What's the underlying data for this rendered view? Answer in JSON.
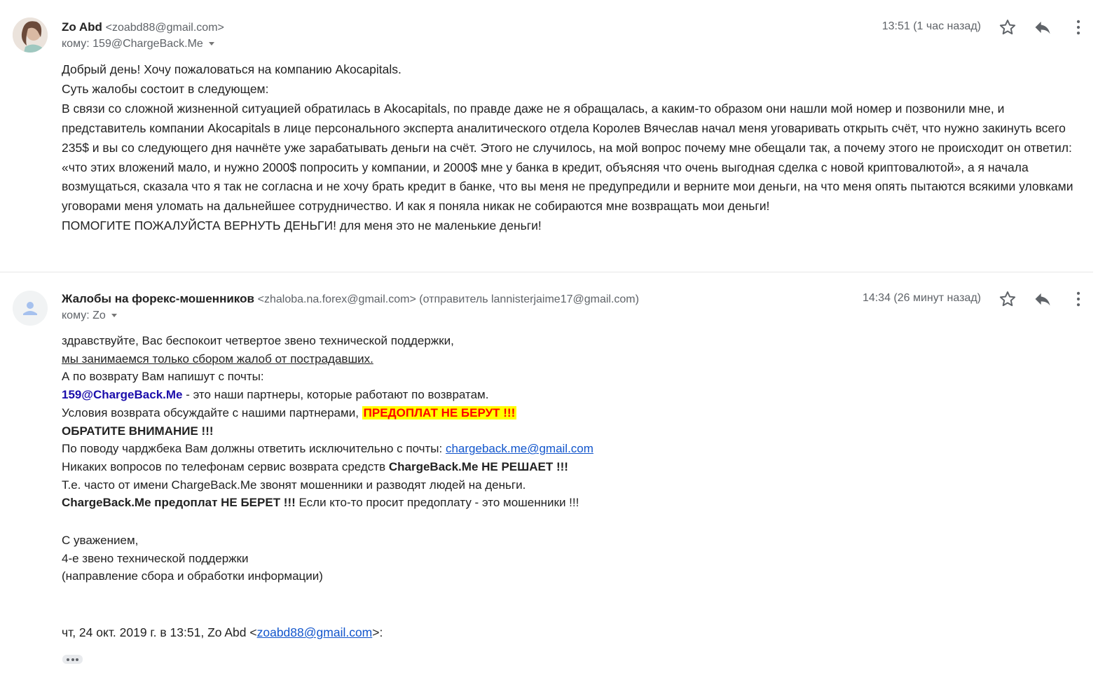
{
  "messages": [
    {
      "sender_name": "Zo Abd",
      "sender_email": "<zoabd88@gmail.com>",
      "to": "кому: 159@ChargeBack.Me",
      "time": "13:51 (1 час назад)",
      "body": [
        "Добрый день! Хочу пожаловаться на компанию Akocapitals.",
        "Суть жалобы состоит в следующем:",
        "В связи со сложной жизненной ситуацией обратилась в Akocapitals, по правде даже не я обращалась, а каким-то образом они нашли мой номер и позвонили мне, и представитель компании Akocapitals в лице персонального эксперта аналитического отдела Королев Вячеслав начал меня уговаривать открыть счёт, что нужно закинуть всего 235$ и вы со следующего дня начнёте уже зарабатывать деньги на счёт. Этого не случилось, на мой вопрос почему мне обещали так, а почему этого не происходит он ответил: «что этих вложений мало, и нужно 2000$ попросить у компании, и 2000$ мне у банка в кредит, объясняя что очень выгодная сделка с новой криптовалютой», а я начала возмущаться, сказала что я так не согласна и не хочу брать кредит в банке, что вы меня не предупредили и верните мои деньги, на что меня опять пытаются всякими уловками уговорами меня уломать на дальнейшее сотрудничество. И как я поняла никак не собираются мне возвращать мои деньги!",
        "ПОМОГИТЕ ПОЖАЛУЙСТА ВЕРНУТЬ ДЕНЬГИ! для меня это не маленькие деньги!"
      ]
    },
    {
      "sender_name": "Жалобы на форекс-мошенников",
      "sender_email": "<zhaloba.na.forex@gmail.com> (отправитель lannisterjaime17@gmail.com)",
      "to": "кому: Zo",
      "time": "14:34 (26 минут назад)",
      "body": {
        "l1": "здравствуйте, Вас беспокоит четвертое звено технической поддержки,",
        "l2": "мы занимаемся только сбором жалоб от пострадавших.",
        "l3": "А по возврату Вам напишут с почты:",
        "l4_email": "159@ChargeBack.Me",
        "l4_text": " - это наши партнеры, которые работают по возвратам.",
        "l5_text": "Условия возврата обсуждайте с нашими партнерами, ",
        "l5_warn": "ПРЕДОПЛАТ НЕ БЕРУТ !!!",
        "l6": "ОБРАТИТЕ ВНИМАНИЕ !!!",
        "l7_text": "По поводу чарджбека Вам должны ответить исключительно с почты: ",
        "l7_link": "chargeback.me@gmail.com",
        "l8_text": "Никаких вопросов по телефонам сервис возврата средств ",
        "l8_bold": "ChargeBack.Me НЕ РЕШАЕТ !!!",
        "l9": "Т.е. часто от имени ChargeBack.Me звонят мошенники и разводят людей на деньги.",
        "l10_bold": "ChargeBack.Me предоплат НЕ БЕРЕТ !!!",
        "l10_text": " Если кто-то просит предоплату - это мошенники !!!",
        "sig1": "С уважением,",
        "sig2": "4-е звено технической поддержки",
        "sig3": "(направление сбора и обработки информации)"
      },
      "quote_prefix": "чт, 24 окт. 2019 г. в 13:51, Zo Abd <",
      "quote_link": "zoabd88@gmail.com",
      "quote_suffix": ">:"
    }
  ],
  "icons": [
    "star-icon",
    "reply-icon",
    "more-vert-icon",
    "avatar-placeholder-icon",
    "ellipsis-icon"
  ]
}
